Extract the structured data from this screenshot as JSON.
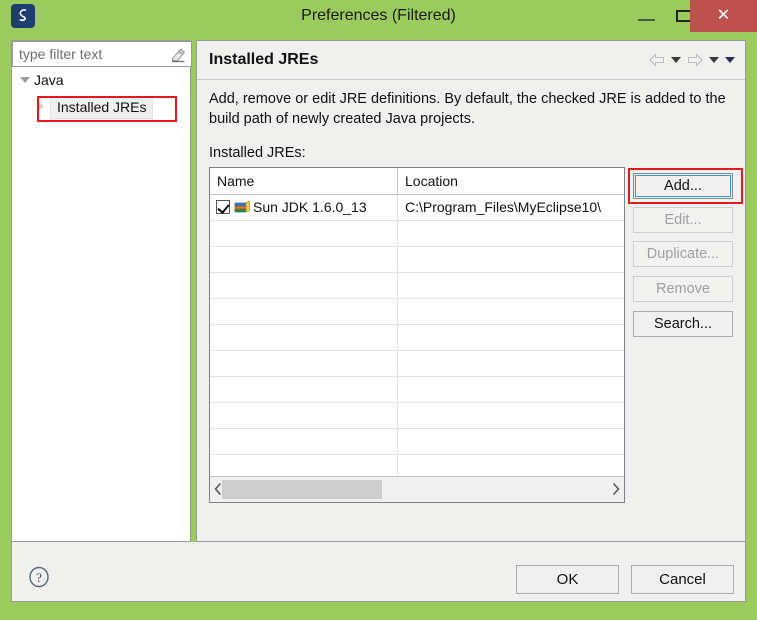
{
  "window": {
    "title": "Preferences (Filtered)",
    "app_icon": "myeclipse-icon",
    "accent_green": "#9BCB5C",
    "close_red": "#C0504D",
    "annotation_red": "#E01B1B",
    "focus_blue": "#3C99D9",
    "controls": {
      "minimize": "minimize-icon",
      "maximize": "maximize-icon",
      "close": "✕"
    }
  },
  "sidebar": {
    "filter": {
      "placeholder": "type filter text",
      "value": "",
      "clear_icon": "eraser-icon"
    },
    "tree": [
      {
        "label": "Java",
        "level": 0,
        "expanded": true,
        "selected": false
      },
      {
        "label": "Installed JREs",
        "level": 1,
        "expanded": false,
        "selected": true
      }
    ]
  },
  "main": {
    "title": "Installed JREs",
    "nav": [
      {
        "name": "back-arrow-icon",
        "enabled": false
      },
      {
        "name": "back-dropdown-caret-icon",
        "enabled": true
      },
      {
        "name": "forward-arrow-icon",
        "enabled": false
      },
      {
        "name": "forward-dropdown-caret-icon",
        "enabled": true
      },
      {
        "name": "menu-caret-icon",
        "enabled": true
      }
    ],
    "description": "Add, remove or edit JRE definitions. By default, the checked JRE is added to the build path of newly created Java projects.",
    "table_label": "Installed JREs:",
    "table": {
      "columns": [
        "Name",
        "Location"
      ],
      "rows": [
        {
          "checked": true,
          "icon": "jre-library-icon",
          "name": "Sun JDK 1.6.0_13",
          "location": "C:\\Program_Files\\MyEclipse10\\"
        }
      ],
      "empty_row_count": 11,
      "hscroll": {
        "left_arrow": "‹",
        "right_arrow": "›",
        "thumb_position": "left"
      }
    },
    "buttons": [
      {
        "label": "Add...",
        "enabled": true,
        "focused": true,
        "annotated": true
      },
      {
        "label": "Edit...",
        "enabled": false,
        "focused": false,
        "annotated": false
      },
      {
        "label": "Duplicate...",
        "enabled": false,
        "focused": false,
        "annotated": false
      },
      {
        "label": "Remove",
        "enabled": false,
        "focused": false,
        "annotated": false
      },
      {
        "label": "Search...",
        "enabled": true,
        "focused": false,
        "annotated": false
      }
    ]
  },
  "footer": {
    "help_icon": "help-question-icon",
    "ok_label": "OK",
    "cancel_label": "Cancel"
  }
}
